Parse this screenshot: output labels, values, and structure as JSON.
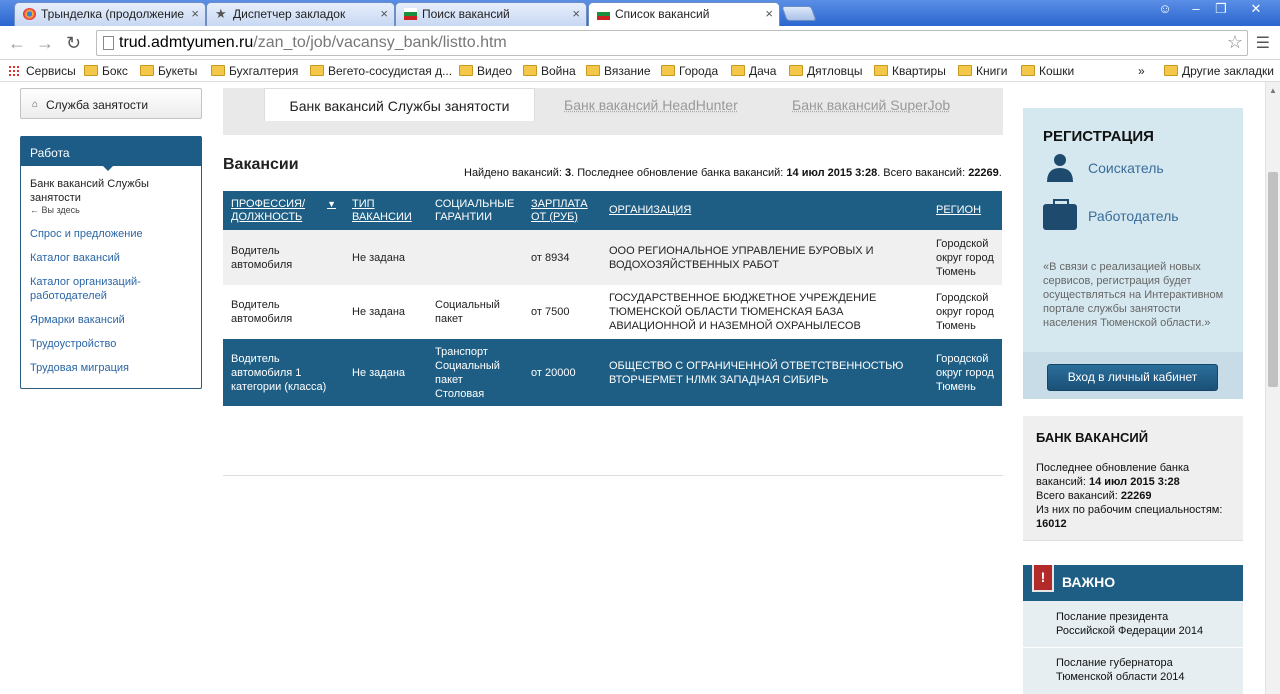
{
  "browser": {
    "tabs": [
      {
        "title": "Трынделка (продолжение"
      },
      {
        "title": "Диспетчер закладок"
      },
      {
        "title": "Поиск вакансий"
      },
      {
        "title": "Список вакансий"
      }
    ],
    "url_host": "trud.admtyumen.ru",
    "url_path": "/zan_to/job/vacansy_bank/listto.htm",
    "bookmarks": [
      "Сервисы",
      "Бокс",
      "Букеты",
      "Бухгалтерия",
      "Вегето-сосудистая д...",
      "Видео",
      "Война",
      "Вязание",
      "Города",
      "Дача",
      "Дятловцы",
      "Квартиры",
      "Книги",
      "Кошки"
    ],
    "more_bookmarks": "»",
    "other_bookmarks": "Другие закладки"
  },
  "left": {
    "service": "Служба занятости",
    "section": "Работа",
    "current": "Банк вакансий Службы занятости",
    "here": "← Вы здесь",
    "items": [
      "Спрос и предложение",
      "Каталог вакансий",
      "Каталог организаций-работодателей",
      "Ярмарки вакансий",
      "Трудоустройство",
      "Трудовая миграция"
    ]
  },
  "main": {
    "tabs": [
      "Банк вакансий Службы занятости",
      "Банк вакансий HeadHunter",
      "Банк вакансий SuperJob"
    ],
    "heading": "Вакансии",
    "found_prefix": "Найдено вакансий: ",
    "found_count": "3",
    "found_mid": ". Последнее обновление банка вакансий: ",
    "found_date": "14 июл 2015 3:28",
    "found_total_label": ". Всего вакансий: ",
    "found_total": "22269",
    "found_end": ".",
    "columns": [
      "ПРОФЕССИЯ/ ДОЛЖНОСТЬ",
      "ТИП ВАКАНСИИ",
      "СОЦИАЛЬНЫЕ ГАРАНТИИ",
      "ЗАРПЛАТА ОТ (РУБ)",
      "ОРГАНИЗАЦИЯ",
      "РЕГИОН"
    ],
    "rows": [
      {
        "profession": "Водитель автомобиля",
        "type": "Не задана",
        "guarantees": "",
        "salary": "от 8934",
        "org": "ООО РЕГИОНАЛЬНОЕ УПРАВЛЕНИЕ БУРОВЫХ И ВОДОХОЗЯЙСТВЕННЫХ РАБОТ",
        "region": "Городской округ город Тюмень"
      },
      {
        "profession": "Водитель автомобиля",
        "type": "Не задана",
        "guarantees": "Социальный пакет",
        "salary": "от 7500",
        "org": "ГОСУДАРСТВЕННОЕ БЮДЖЕТНОЕ УЧРЕЖДЕНИЕ ТЮМЕНСКОЙ ОБЛАСТИ ТЮМЕНСКАЯ БАЗА АВИАЦИОННОЙ И НАЗЕМНОЙ ОХРАНЫЛЕСОВ",
        "region": "Городской округ город Тюмень"
      },
      {
        "profession": "Водитель автомобиля 1 категории (класса)",
        "type": "Не задана",
        "guarantees": "Транспорт Социальный пакет Столовая",
        "salary": "от 20000",
        "org": "ОБЩЕСТВО С ОГРАНИЧЕННОЙ ОТВЕТСТВЕННОСТЬЮ ВТОРЧЕРМЕТ НЛМК ЗАПАДНАЯ СИБИРЬ",
        "region": "Городской округ город Тюмень"
      }
    ]
  },
  "right": {
    "reg_title": "РЕГИСТРАЦИЯ",
    "seeker": "Соискатель",
    "employer": "Работодатель",
    "note": "«В связи с реализацией новых сервисов, регистрация будет осуществляться на Интерактивном портале службы занятости населения Тюменской области.»",
    "login": "Вход в личный кабинет",
    "bank_title": "БАНК ВАКАНСИЙ",
    "bank_update_label": "Последнее обновление банка вакансий: ",
    "bank_update": "14 июл 2015 3:28",
    "bank_total_label": "Всего вакансий: ",
    "bank_total": "22269",
    "bank_work_label": "Из них по рабочим специальностям: ",
    "bank_work": "16012",
    "important_title": "ВАЖНО",
    "important_items": [
      "Послание президента Российской Федерации 2014",
      "Послание губернатора Тюменской области 2014"
    ]
  }
}
